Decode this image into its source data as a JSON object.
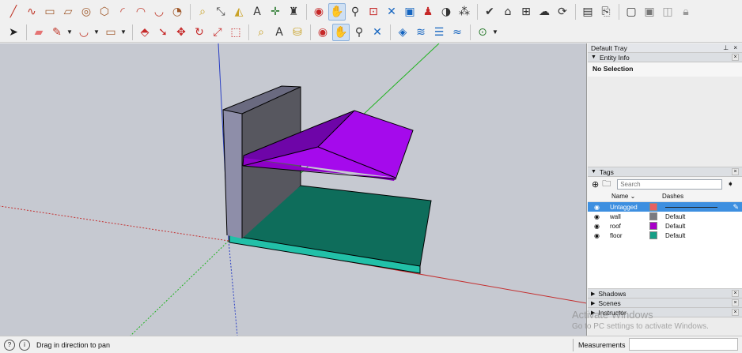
{
  "toolbar_top": {
    "tools": [
      {
        "icon": "line-tool-icon",
        "glyph": "╱",
        "color": "#c0392b"
      },
      {
        "icon": "freehand-tool-icon",
        "glyph": "∿",
        "color": "#c0392b"
      },
      {
        "icon": "rectangle-tool-icon",
        "glyph": "▭",
        "color": "#a05a2c"
      },
      {
        "icon": "rotated-rectangle-icon",
        "glyph": "▱",
        "color": "#a05a2c"
      },
      {
        "icon": "circle-tool-icon",
        "glyph": "◎",
        "color": "#a05a2c"
      },
      {
        "icon": "polygon-tool-icon",
        "glyph": "⬡",
        "color": "#a05a2c"
      },
      {
        "icon": "arc-tool-icon",
        "glyph": "◜",
        "color": "#c0392b"
      },
      {
        "icon": "two-point-arc-icon",
        "glyph": "◠",
        "color": "#c0392b"
      },
      {
        "icon": "three-point-arc-icon",
        "glyph": "◡",
        "color": "#c0392b"
      },
      {
        "icon": "pie-tool-icon",
        "glyph": "◔",
        "color": "#a05a2c"
      },
      {
        "sep": true
      },
      {
        "icon": "tape-measure-icon",
        "glyph": "⌕",
        "color": "#c9a227"
      },
      {
        "icon": "dimension-tool-icon",
        "glyph": "⤡",
        "color": "#444"
      },
      {
        "icon": "protractor-icon",
        "glyph": "◭",
        "color": "#c9a227"
      },
      {
        "icon": "text-tool-icon",
        "glyph": "A",
        "color": "#333"
      },
      {
        "icon": "axes-tool-icon",
        "glyph": "✛",
        "color": "#2e7d32"
      },
      {
        "icon": "3d-text-icon",
        "glyph": "♜",
        "color": "#333"
      },
      {
        "sep": true
      },
      {
        "icon": "orbit-icon",
        "glyph": "◉",
        "color": "#c62828"
      },
      {
        "icon": "pan-hand-icon",
        "glyph": "✋",
        "color": "#c9a227",
        "active": true
      },
      {
        "icon": "zoom-icon",
        "glyph": "⚲",
        "color": "#333"
      },
      {
        "icon": "zoom-window-icon",
        "glyph": "⊡",
        "color": "#c62828"
      },
      {
        "icon": "zoom-extents-icon",
        "glyph": "✕",
        "color": "#1565c0"
      },
      {
        "icon": "previous-view-icon",
        "glyph": "▣",
        "color": "#1565c0"
      },
      {
        "icon": "position-camera-icon",
        "glyph": "♟",
        "color": "#c62828"
      },
      {
        "icon": "look-around-icon",
        "glyph": "◑",
        "color": "#333"
      },
      {
        "icon": "walk-icon",
        "glyph": "⁂",
        "color": "#333"
      },
      {
        "sep": true
      },
      {
        "icon": "model-info-icon",
        "glyph": "✔",
        "color": "#333"
      },
      {
        "icon": "warehouse-icon",
        "glyph": "⌂",
        "color": "#333"
      },
      {
        "icon": "extension-warehouse-icon",
        "glyph": "⊞",
        "color": "#333"
      },
      {
        "icon": "cloud-icon",
        "glyph": "☁",
        "color": "#333"
      },
      {
        "icon": "sync-icon",
        "glyph": "⟳",
        "color": "#333"
      },
      {
        "sep": true
      },
      {
        "icon": "layout-send-icon",
        "glyph": "▤",
        "color": "#333"
      },
      {
        "icon": "share-model-icon",
        "glyph": "⎘",
        "color": "#333"
      },
      {
        "sep": true
      },
      {
        "icon": "window-icon",
        "glyph": "▢",
        "color": "#333"
      },
      {
        "icon": "component-window-icon",
        "glyph": "▣",
        "color": "#777"
      },
      {
        "icon": "material-window-icon",
        "glyph": "◫",
        "color": "#999"
      },
      {
        "icon": "lock-icon",
        "glyph": "🔒︎",
        "color": "#999"
      }
    ]
  },
  "toolbar_bottom": {
    "tools": [
      {
        "icon": "select-arrow-icon",
        "glyph": "➤",
        "color": "#222"
      },
      {
        "sep": true
      },
      {
        "icon": "eraser-icon",
        "glyph": "▰",
        "color": "#e57373"
      },
      {
        "icon": "pencil-icon",
        "glyph": "✎",
        "color": "#c0392b",
        "caret": true
      },
      {
        "icon": "arc-dropdown-icon",
        "glyph": "◡",
        "color": "#c0392b",
        "caret": true
      },
      {
        "icon": "shape-dropdown-icon",
        "glyph": "▭",
        "color": "#a05a2c",
        "caret": true
      },
      {
        "sep": true
      },
      {
        "icon": "push-pull-icon",
        "glyph": "⬘",
        "color": "#c62828"
      },
      {
        "icon": "follow-me-icon",
        "glyph": "➘",
        "color": "#c62828"
      },
      {
        "icon": "move-icon",
        "glyph": "✥",
        "color": "#c62828"
      },
      {
        "icon": "rotate-icon",
        "glyph": "↻",
        "color": "#c62828"
      },
      {
        "icon": "scale-icon",
        "glyph": "⤢",
        "color": "#c62828"
      },
      {
        "icon": "offset-icon",
        "glyph": "⬚",
        "color": "#c62828"
      },
      {
        "sep": true
      },
      {
        "icon": "tape-measure-2-icon",
        "glyph": "⌕",
        "color": "#c9a227"
      },
      {
        "icon": "text-label-icon",
        "glyph": "A",
        "color": "#333"
      },
      {
        "icon": "paint-bucket-icon",
        "glyph": "⛁",
        "color": "#c9a227"
      },
      {
        "sep": true
      },
      {
        "icon": "orbit-2-icon",
        "glyph": "◉",
        "color": "#c62828"
      },
      {
        "icon": "pan-2-icon",
        "glyph": "✋",
        "color": "#c9a227",
        "active": true
      },
      {
        "icon": "zoom-2-icon",
        "glyph": "⚲",
        "color": "#333"
      },
      {
        "icon": "zoom-extents-2-icon",
        "glyph": "✕",
        "color": "#1565c0"
      },
      {
        "sep": true
      },
      {
        "icon": "solid-tools-icon",
        "glyph": "◈",
        "color": "#1565c0"
      },
      {
        "icon": "sandbox-icon",
        "glyph": "≋",
        "color": "#1565c0"
      },
      {
        "icon": "stamp-icon",
        "glyph": "☰",
        "color": "#1565c0"
      },
      {
        "icon": "drape-icon",
        "glyph": "≈",
        "color": "#1565c0"
      },
      {
        "sep": true
      },
      {
        "icon": "geo-location-icon",
        "glyph": "⊙",
        "color": "#2e7d32",
        "caret": true
      }
    ]
  },
  "tray": {
    "title": "Default Tray",
    "pins": "⊥ ×",
    "entity_info": {
      "header": "Entity Info",
      "selection": "No Selection"
    },
    "tags": {
      "header": "Tags",
      "search_placeholder": "Search",
      "col_name": "Name",
      "col_dashes": "Dashes",
      "rows": [
        {
          "name": "Untagged",
          "color": "#e86060",
          "dash": "",
          "selected": true
        },
        {
          "name": "wall",
          "color": "#7a7a80",
          "dash": "Default",
          "selected": false
        },
        {
          "name": "roof",
          "color": "#a800c8",
          "dash": "Default",
          "selected": false
        },
        {
          "name": "floor",
          "color": "#159e86",
          "dash": "Default",
          "selected": false
        }
      ]
    },
    "collapsed": [
      "Shadows",
      "Scenes",
      "Instructor"
    ]
  },
  "status": {
    "text": "Drag in direction to pan",
    "measurements_label": "Measurements"
  },
  "watermark": {
    "line1": "Activate Windows",
    "line2": "Go to PC settings to activate Windows."
  },
  "colors": {
    "wall_front": "#8e8ea9",
    "wall_side": "#57575f",
    "roof_light": "#a50aec",
    "roof_dark": "#6e05a8",
    "floor_top": "#0e6d5b",
    "floor_edge": "#22c0a8"
  }
}
